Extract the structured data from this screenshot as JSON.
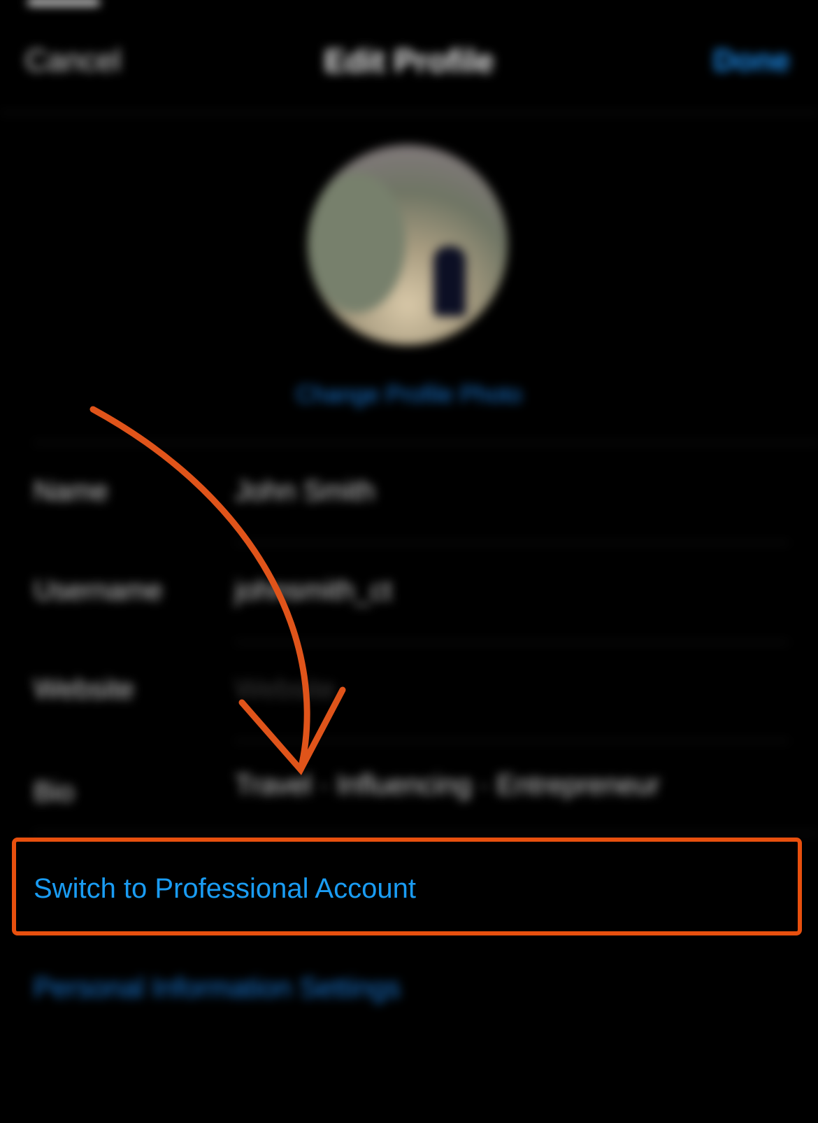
{
  "nav": {
    "cancel_label": "Cancel",
    "title": "Edit Profile",
    "done_label": "Done"
  },
  "profile": {
    "change_photo_label": "Change Profile Photo"
  },
  "fields": [
    {
      "label": "Name",
      "value": "John Smith"
    },
    {
      "label": "Username",
      "value": "johnsmith_ct"
    },
    {
      "label": "Website",
      "value": "Website"
    },
    {
      "label": "Bio",
      "value": "Travel · Influencing · Entrepreneur"
    }
  ],
  "links": {
    "switch_professional": "Switch to Professional Account",
    "personal_info": "Personal Information Settings"
  },
  "annotation": {
    "highlight_color": "#e8500e",
    "arrow_color": "#e0541a"
  },
  "colors": {
    "background": "#000000",
    "link_blue": "#1a9cf3"
  }
}
